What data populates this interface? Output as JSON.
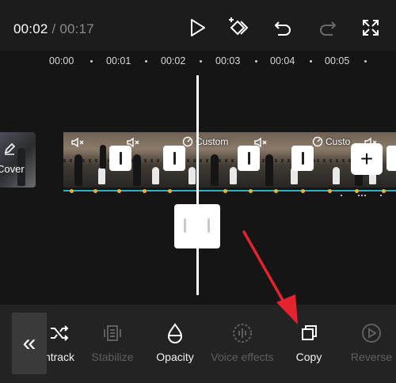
{
  "header": {
    "current_time": "00:02",
    "separator": " / ",
    "duration": "00:17"
  },
  "ruler": {
    "ticks": [
      "00:00",
      "00:01",
      "00:02",
      "00:03",
      "00:04",
      "00:05"
    ]
  },
  "timeline": {
    "cover_label": "Cover",
    "custom_badge_1": "Custom",
    "custom_badge_2": "Custo"
  },
  "toolbar": {
    "items": [
      {
        "label": "ntrack",
        "enabled": true
      },
      {
        "label": "Stabilize",
        "enabled": false
      },
      {
        "label": "Opacity",
        "enabled": true
      },
      {
        "label": "Voice effects",
        "enabled": false
      },
      {
        "label": "Copy",
        "enabled": true
      },
      {
        "label": "Reverse",
        "enabled": false
      }
    ]
  },
  "colors": {
    "accent_track": "#2cb3b3",
    "keyframe": "#e8b23a",
    "annotation_arrow": "#e5232f"
  }
}
